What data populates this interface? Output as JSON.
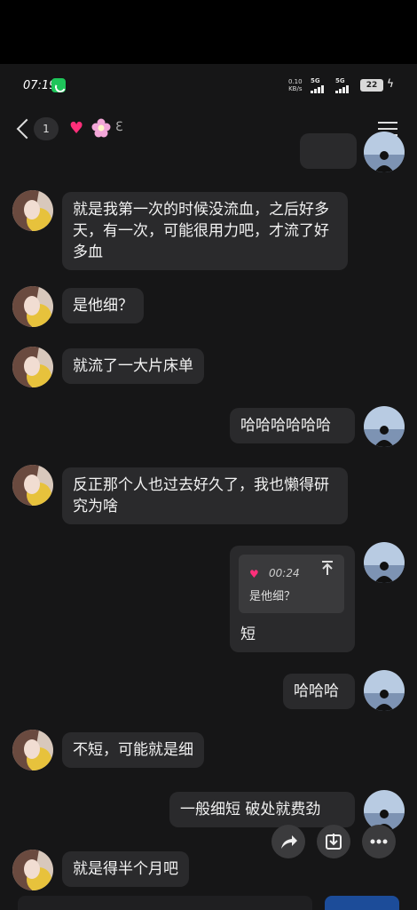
{
  "status": {
    "time": "07:19",
    "net_speed_top": "0.10",
    "net_speed_bottom": "KB/s",
    "sim1": "5G",
    "sim2": "5G",
    "battery": "22"
  },
  "header": {
    "unread_count": "1",
    "icons": [
      "back-icon",
      "heart-icon",
      "flower-icon",
      "ear-icon",
      "menu-icon"
    ]
  },
  "messages": [
    {
      "side": "left",
      "text": "就是我第一次的时候没流血，之后好多天，有一次，可能很用力吧，才流了好多血"
    },
    {
      "side": "left",
      "text": "是他细？"
    },
    {
      "side": "left",
      "text": "就流了一大片床单"
    },
    {
      "side": "right",
      "text": "哈哈哈哈哈哈"
    },
    {
      "side": "left",
      "text": "反正那个人也过去好久了，我也懒得研究为啥"
    },
    {
      "side": "right",
      "quote_time": "00:24",
      "quote_text": "是他细？",
      "text": "短"
    },
    {
      "side": "right",
      "text": "哈哈哈"
    },
    {
      "side": "left",
      "text": "不短，可能就是细"
    },
    {
      "side": "right",
      "text": "一般细短 破处就费劲"
    },
    {
      "side": "left",
      "text": "就是得半个月吧"
    }
  ],
  "colors": {
    "background": "#161617",
    "bubble": "#2a2a2c",
    "accent_heart": "#ff2f7a",
    "badge_green": "#1ec55a"
  }
}
